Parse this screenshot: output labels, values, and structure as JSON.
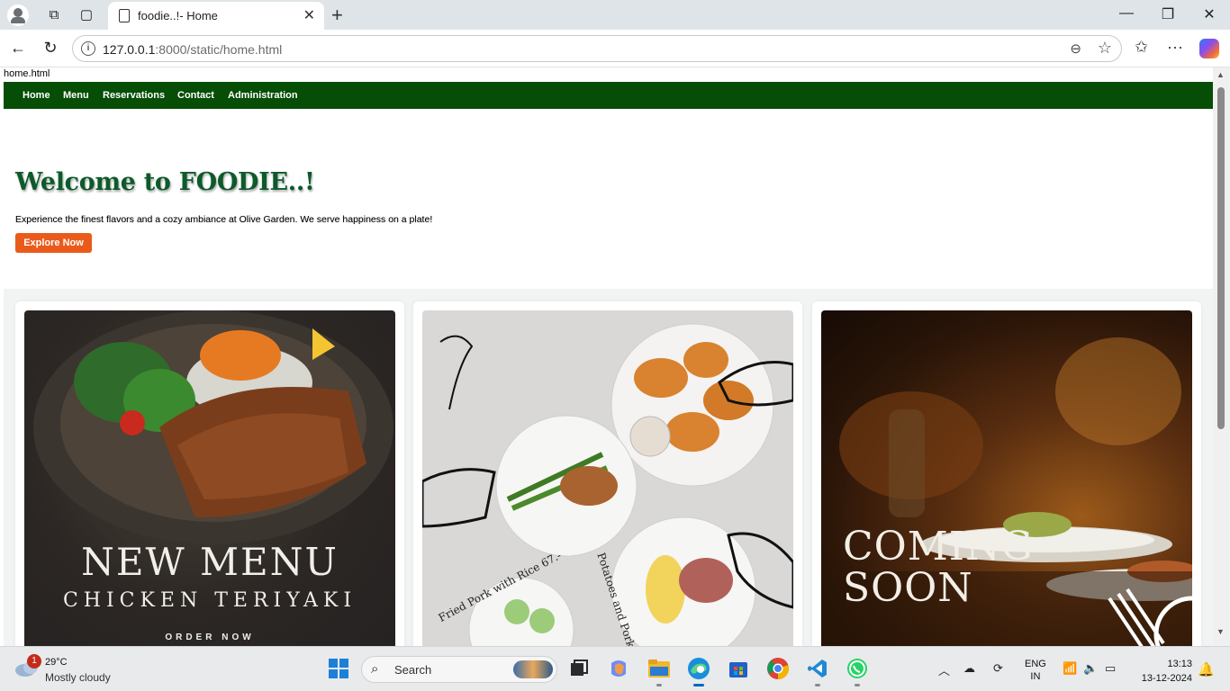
{
  "browser": {
    "tab_title": "foodie..!- Home",
    "url_host": "127.0.0.1",
    "url_rest": ":8000/static/home.html",
    "new_tab_glyph": "+",
    "close_tab_glyph": "✕"
  },
  "page": {
    "filename": "home.html",
    "nav": [
      "Home",
      "Menu",
      "Reservations",
      "Contact",
      "Administration"
    ],
    "hero": {
      "heading": "Welcome to FOODIE..!",
      "tagline": "Experience the finest flavors and a cozy ambiance at Olive Garden. We serve happiness on a plate!",
      "cta": "Explore Now"
    },
    "cards": [
      {
        "line1": "NEW MENU",
        "line2": "CHICKEN TERIYAKI",
        "line3": "ORDER NOW"
      },
      {
        "curved1": "Fried Pork with Rice 67.-",
        "curved2": "Potatoes and Pork"
      },
      {
        "line1": "COMING",
        "line2": "SOON"
      }
    ]
  },
  "taskbar": {
    "weather_badge": "1",
    "temperature": "29°C",
    "weather": "Mostly cloudy",
    "search_placeholder": "Search",
    "lang_line1": "ENG",
    "lang_line2": "IN",
    "time": "13:13",
    "date": "13-12-2024"
  },
  "colors": {
    "nav_bg": "#064d06",
    "heading": "#0d5a2a",
    "cta_bg": "#ea5a1b"
  }
}
